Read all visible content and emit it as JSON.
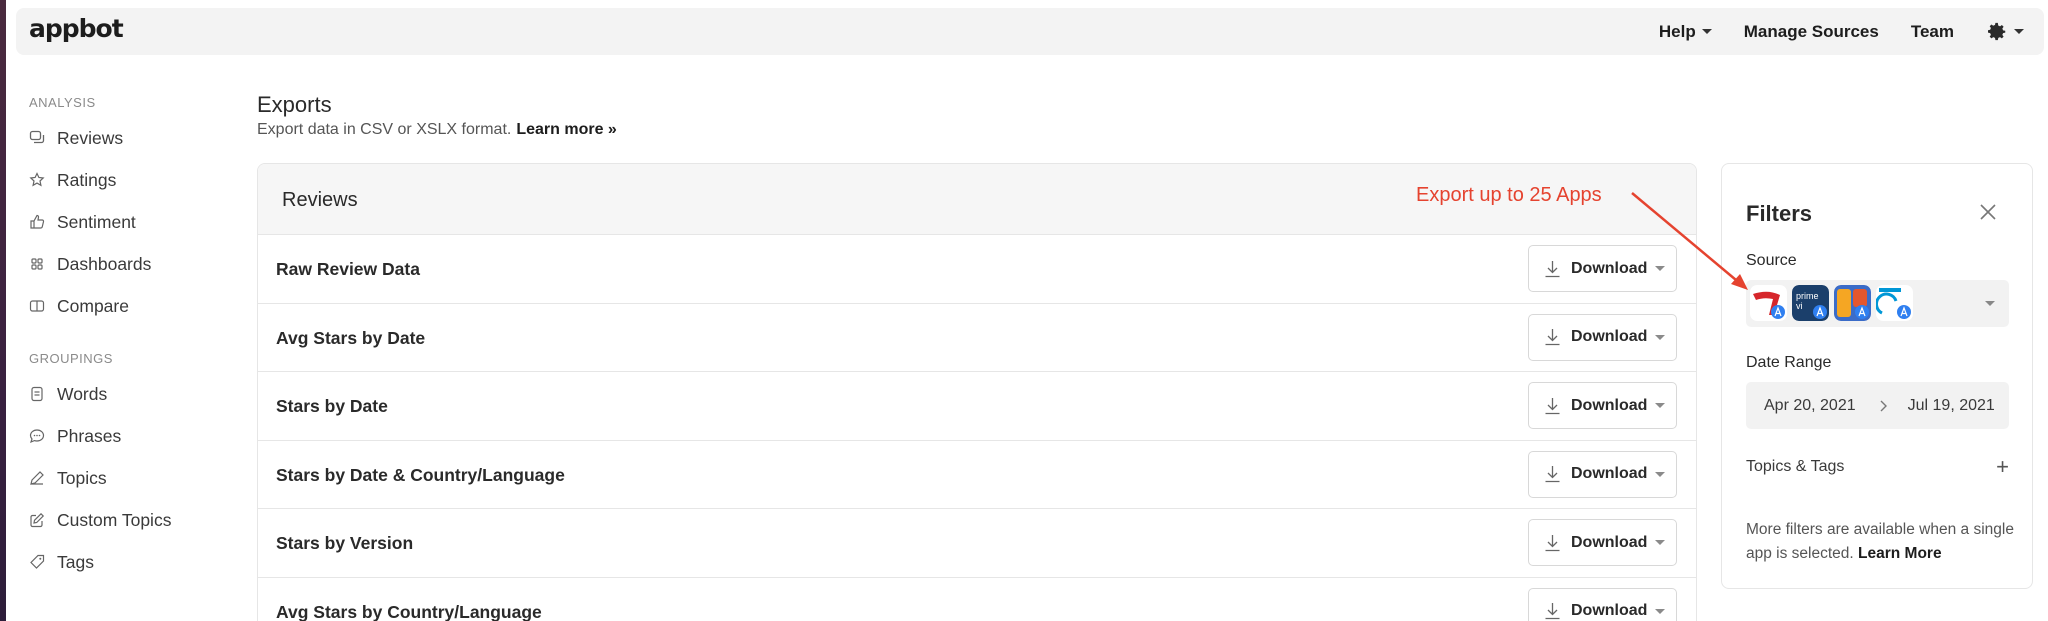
{
  "brand": {
    "logo": "appbot"
  },
  "topnav": {
    "help": "Help",
    "manage_sources": "Manage Sources",
    "team": "Team"
  },
  "sidebar": {
    "analysis_label": "ANALYSIS",
    "analysis_items": [
      {
        "label": "Reviews",
        "icon": "reviews-icon"
      },
      {
        "label": "Ratings",
        "icon": "star-icon"
      },
      {
        "label": "Sentiment",
        "icon": "thumbs-up-icon"
      },
      {
        "label": "Dashboards",
        "icon": "grid-icon"
      },
      {
        "label": "Compare",
        "icon": "compare-icon"
      }
    ],
    "groupings_label": "GROUPINGS",
    "groupings_items": [
      {
        "label": "Words",
        "icon": "document-icon"
      },
      {
        "label": "Phrases",
        "icon": "chat-icon"
      },
      {
        "label": "Topics",
        "icon": "pencil-icon"
      },
      {
        "label": "Custom Topics",
        "icon": "edit-icon"
      },
      {
        "label": "Tags",
        "icon": "tag-icon"
      }
    ]
  },
  "main": {
    "title": "Exports",
    "subtitle": "Export data in CSV or XSLX format.",
    "learn_more": "Learn more »"
  },
  "reviews_card": {
    "title": "Reviews",
    "annotation": "Export up to 25 Apps",
    "download_label": "Download",
    "rows": [
      "Raw Review Data",
      "Avg Stars by Date",
      "Stars by Date",
      "Stars by Date & Country/Language",
      "Stars by Version",
      "Avg Stars by Country/Language"
    ]
  },
  "filters": {
    "title": "Filters",
    "source_label": "Source",
    "source_apps": [
      {
        "icon": "red-app-icon",
        "color": "#d6262b"
      },
      {
        "icon": "prime-video-icon",
        "color": "#1b3f6b",
        "text": "prime video"
      },
      {
        "icon": "game-app-icon",
        "color": "#3b6cc8"
      },
      {
        "icon": "daikin-app-icon",
        "color": "#ffffff"
      }
    ],
    "date_range_label": "Date Range",
    "date_from": "Apr 20, 2021",
    "date_to": "Jul 19, 2021",
    "topics_tags": "Topics & Tags",
    "note_text": "More filters are available when a single app is selected.",
    "note_link": "Learn More"
  },
  "colors": {
    "annotation": "#e5432f",
    "navbar_bg": "#f3f3f3",
    "card_head_bg": "#f6f6f6"
  }
}
